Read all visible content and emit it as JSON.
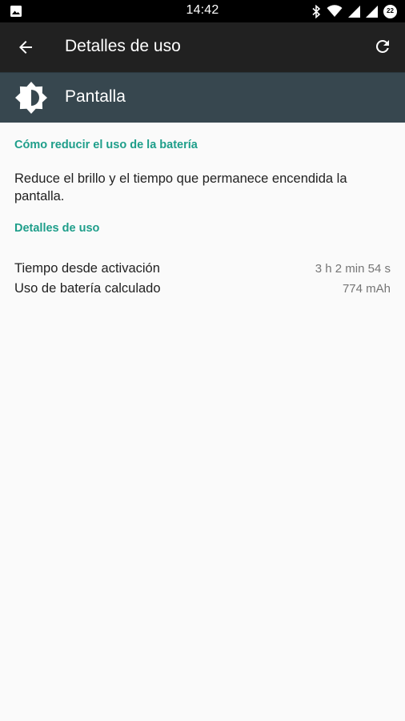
{
  "status_bar": {
    "time": "14:42",
    "battery_level": "22",
    "icons": [
      "image-icon",
      "bluetooth-icon",
      "wifi-icon",
      "signal-icon",
      "signal-icon",
      "battery-icon"
    ]
  },
  "app_bar": {
    "title": "Detalles de uso",
    "back_icon": "arrow-back-icon",
    "refresh_icon": "refresh-icon"
  },
  "header": {
    "label": "Pantalla",
    "icon": "brightness-icon"
  },
  "tip_section": {
    "title": "Cómo reducir el uso de la batería",
    "text": "Reduce el brillo y el tiempo que permanece encendida la pantalla."
  },
  "usage_section": {
    "title": "Detalles de uso",
    "rows": [
      {
        "label": "Tiempo desde activación",
        "value": "3 h 2 min 54 s"
      },
      {
        "label": "Uso de batería calculado",
        "value": "774 mAh"
      }
    ]
  },
  "colors": {
    "status_bar": "#000000",
    "app_bar": "#212121",
    "header_band": "#37474f",
    "accent": "#1e9e8a",
    "background": "#fafafa"
  }
}
